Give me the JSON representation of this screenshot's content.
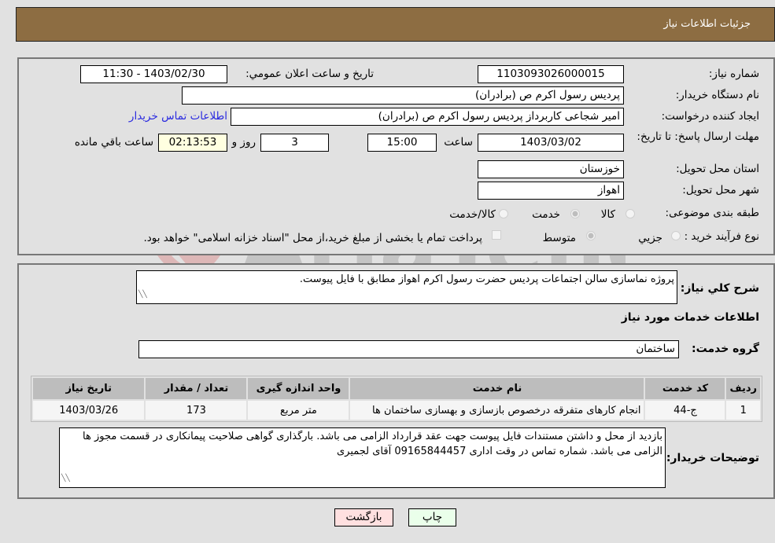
{
  "header": {
    "title": "جزئیات اطلاعات نیاز"
  },
  "details": {
    "need_number_label": "شماره نیاز:",
    "need_number": "1103093026000015",
    "announce_label": "تاریخ و ساعت اعلان عمومي:",
    "announce_value": "1403/02/30 - 11:30",
    "buyer_org_label": "نام دستگاه خریدار:",
    "buyer_org": "پردیس رسول اکرم ص (برادران)",
    "creator_label": "ایجاد کننده درخواست:",
    "creator": "امیر  شجاعی کاربرداز پردیس رسول اکرم ص (برادران)",
    "contact_link": "اطلاعات تماس خریدار",
    "deadline_label": "مهلت ارسال پاسخ: تا تاریخ:",
    "deadline_date": "1403/03/02",
    "time_label": "ساعت",
    "deadline_time": "15:00",
    "days_value": "3",
    "days_label": "روز و",
    "remaining_time": "02:13:53",
    "remaining_label": "ساعت باقي مانده",
    "province_label": "استان محل تحویل:",
    "province": "خوزستان",
    "city_label": "شهر محل تحویل:",
    "city": "اهواز",
    "category_label": "طبقه بندی موضوعی:",
    "category_options": [
      {
        "label": "کالا",
        "checked": false
      },
      {
        "label": "خدمت",
        "checked": true
      },
      {
        "label": "کالا/خدمت",
        "checked": false
      }
    ],
    "process_label": "نوع فرآیند خرید :",
    "process_options": [
      {
        "label": "جزيي",
        "checked": false
      },
      {
        "label": "متوسط",
        "checked": true
      }
    ],
    "treasury_checkbox_label": "پرداخت تمام یا بخشی از مبلغ خرید،از محل \"اسناد خزانه اسلامی\" خواهد بود.",
    "treasury_checked": false
  },
  "description": {
    "label": "شرح كلي نیاز:",
    "value": "پروژه نماسازی سالن اجتماعات پردیس حضرت رسول اکرم اهواز مطابق با فایل پیوست.",
    "services_heading": "اطلاعات خدمات مورد نیاز",
    "service_group_label": "گروه خدمت:",
    "service_group": "ساختمان"
  },
  "table": {
    "headers": [
      "ردیف",
      "کد خدمت",
      "نام خدمت",
      "واحد اندازه گیری",
      "تعداد / مقدار",
      "تاریخ نیاز"
    ],
    "rows": [
      [
        "1",
        "ج-44",
        "انجام کارهای متفرقه درخصوص بازسازی و بهسازی ساختمان ها",
        "متر مربع",
        "173",
        "1403/03/26"
      ]
    ]
  },
  "buyer_notes": {
    "label": "توضیحات خریدار:",
    "value": "بازدید از محل و داشتن مستندات فایل پیوست جهت عقد قرارداد الزامی می باشد. بارگذاری گواهی صلاحیت پیمانکاری در قسمت مجوز ها الزامی می باشد. شماره تماس در وقت اداری 09165844457 آقای لجمیری"
  },
  "buttons": {
    "print": "چاپ",
    "back": "بازگشت"
  },
  "colors": {
    "header_bg": "#8d6d42",
    "print_bg": "#eaffea",
    "back_bg": "#ffe0e0",
    "link": "#2a2ae0"
  }
}
